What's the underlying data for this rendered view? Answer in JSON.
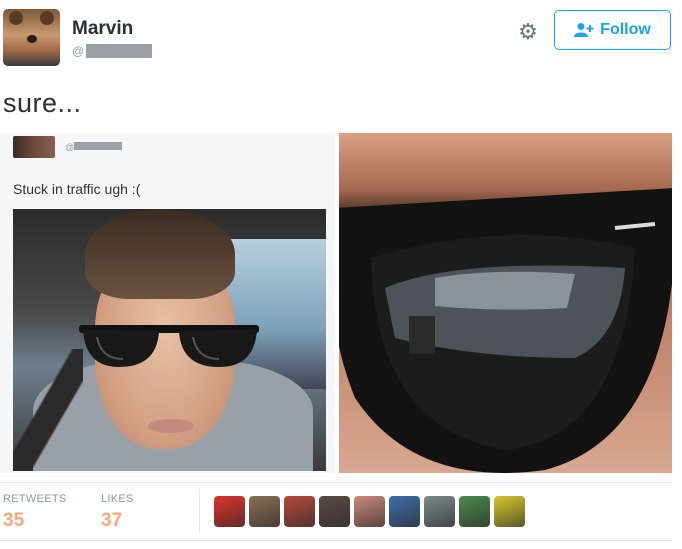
{
  "user": {
    "display_name": "Marvin",
    "handle_prefix": "@"
  },
  "header": {
    "follow_label": "Follow"
  },
  "tweet": {
    "text": "sure..."
  },
  "quoted": {
    "handle_prefix": "@",
    "text": "Stuck in traffic ugh :("
  },
  "stats": {
    "retweets_label": "RETWEETS",
    "retweets_value": "35",
    "likes_label": "LIKES",
    "likes_value": "37"
  },
  "likers": [
    {
      "name": "liker-avatar-1",
      "color": "#e0332c"
    },
    {
      "name": "liker-avatar-2",
      "color": "#8c6e54"
    },
    {
      "name": "liker-avatar-3",
      "color": "#b54a3a"
    },
    {
      "name": "liker-avatar-4",
      "color": "#5b4a44"
    },
    {
      "name": "liker-avatar-5",
      "color": "#cc8a7a"
    },
    {
      "name": "liker-avatar-6",
      "color": "#3c6ea8"
    },
    {
      "name": "liker-avatar-7",
      "color": "#7c8a8c"
    },
    {
      "name": "liker-avatar-8",
      "color": "#4a8a4c"
    },
    {
      "name": "liker-avatar-9",
      "color": "#d8c82c"
    }
  ],
  "colors": {
    "accent": "#1da1f2",
    "stat_value": "#f5a97c",
    "muted": "#8899a6"
  }
}
